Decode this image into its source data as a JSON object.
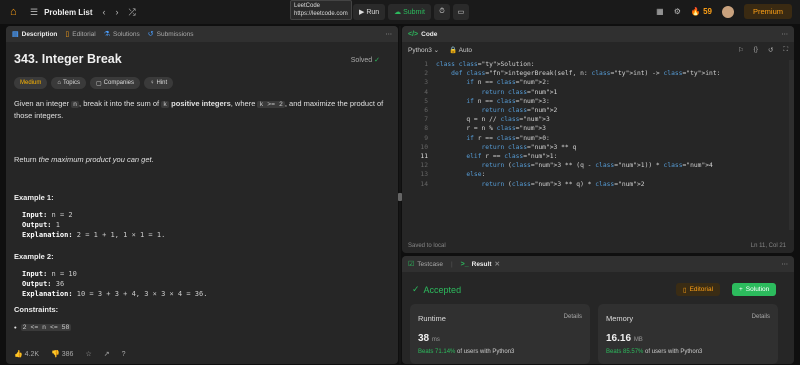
{
  "topbar": {
    "title": "Problem List",
    "run": "Run",
    "submit": "Submit",
    "tooltip_line1": "LeetCode",
    "tooltip_line2": "https://leetcode.com",
    "streak": "59",
    "premium": "Premium"
  },
  "left": {
    "tabs": [
      "Description",
      "Editorial",
      "Solutions",
      "Submissions"
    ],
    "title": "343. Integer Break",
    "solved": "Solved",
    "tags": [
      "Medium",
      "Topics",
      "Companies",
      "Hint"
    ],
    "desc_1": "Given an integer ",
    "desc_n": "n",
    "desc_2": ", break it into the sum of ",
    "desc_k": "k",
    "desc_3": "positive integers",
    "desc_4": ", where ",
    "desc_k2": "k >= 2",
    "desc_5": ", and maximize the product of those integers.",
    "return_1": "Return ",
    "return_2": "the maximum product you can get",
    "return_3": ".",
    "ex1_title": "Example 1:",
    "ex1_input_l": "Input:",
    "ex1_input": " n = 2",
    "ex1_output_l": "Output:",
    "ex1_output": " 1",
    "ex1_expl_l": "Explanation:",
    "ex1_expl": " 2 = 1 + 1, 1 × 1 = 1.",
    "ex2_title": "Example 2:",
    "ex2_input_l": "Input:",
    "ex2_input": " n = 10",
    "ex2_output_l": "Output:",
    "ex2_output": " 36",
    "ex2_expl_l": "Explanation:",
    "ex2_expl": " 10 = 3 + 3 + 4, 3 × 3 × 4 = 36.",
    "constraints_title": "Constraints:",
    "constraint_1": "2 <= n <= 58",
    "likes": "4.2K",
    "dislikes": "386"
  },
  "code": {
    "tab": "Code",
    "language": "Python3",
    "auto": "Auto",
    "lines": [
      "class Solution:",
      "    def integerBreak(self, n: int) -> int:",
      "        if n == 2:",
      "            return 1",
      "        if n == 3:",
      "            return 2",
      "        q = n // 3",
      "        r = n % 3",
      "        if r == 0:",
      "            return 3 ** q",
      "        elif r == 1:",
      "            return (3 ** (q - 1)) * 4",
      "        else:",
      "            return (3 ** q) * 2"
    ],
    "saved": "Saved to local",
    "position": "Ln 11, Col 21"
  },
  "result": {
    "tabs": [
      "Testcase",
      "Result"
    ],
    "status": "Accepted",
    "editorial": "Editorial",
    "solution": "Solution",
    "runtime_label": "Runtime",
    "runtime_value": "38",
    "runtime_unit": "ms",
    "runtime_beats_pct": "Beats 71.14%",
    "runtime_beats_rest": " of users with Python3",
    "memory_label": "Memory",
    "memory_value": "16.16",
    "memory_unit": "MB",
    "memory_beats_pct": "Beats 85.57%",
    "memory_beats_rest": " of users with Python3",
    "details": "Details"
  },
  "colors": {
    "accent": "#ffa116",
    "success": "#2cbb5d",
    "medium": "#ffb700"
  }
}
